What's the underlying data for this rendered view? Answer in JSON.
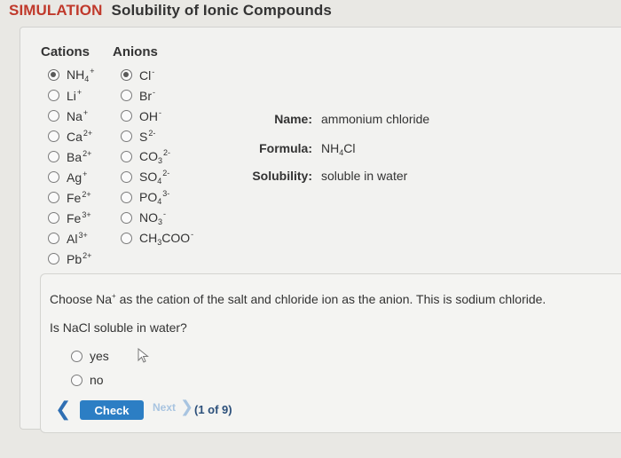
{
  "header": {
    "prefix": "SIMULATION",
    "title": "Solubility of Ionic Compounds"
  },
  "cations": {
    "heading": "Cations",
    "selected": "NH4+",
    "items": [
      {
        "base": "NH",
        "sub": "4",
        "sup": "+"
      },
      {
        "base": "Li",
        "sub": "",
        "sup": "+"
      },
      {
        "base": "Na",
        "sub": "",
        "sup": "+"
      },
      {
        "base": "Ca",
        "sub": "",
        "sup": "2+"
      },
      {
        "base": "Ba",
        "sub": "",
        "sup": "2+"
      },
      {
        "base": "Ag",
        "sub": "",
        "sup": "+"
      },
      {
        "base": "Fe",
        "sub": "",
        "sup": "2+"
      },
      {
        "base": "Fe",
        "sub": "",
        "sup": "3+"
      },
      {
        "base": "Al",
        "sub": "",
        "sup": "3+"
      },
      {
        "base": "Pb",
        "sub": "",
        "sup": "2+"
      }
    ]
  },
  "anions": {
    "heading": "Anions",
    "selected": "Cl-",
    "items": [
      {
        "base": "Cl",
        "sub": "",
        "sup": "-"
      },
      {
        "base": "Br",
        "sub": "",
        "sup": "-"
      },
      {
        "base": "OH",
        "sub": "",
        "sup": "-"
      },
      {
        "base": "S",
        "sub": "",
        "sup": "2-"
      },
      {
        "base": "CO",
        "sub": "3",
        "sup": "2-"
      },
      {
        "base": "SO",
        "sub": "4",
        "sup": "2-"
      },
      {
        "base": "PO",
        "sub": "4",
        "sup": "3-"
      },
      {
        "base": "NO",
        "sub": "3",
        "sup": "-"
      },
      {
        "base": "CH",
        "sub": "3",
        "tail": "COO",
        "sup": "-"
      }
    ]
  },
  "info": {
    "name_label": "Name:",
    "name_value": "ammonium chloride",
    "formula_label": "Formula:",
    "formula_base": "NH",
    "formula_sub": "4",
    "formula_tail": "Cl",
    "solubility_label": "Solubility:",
    "solubility_value": "soluble in water"
  },
  "question": {
    "line1_a": "Choose Na",
    "line1_sup": "+",
    "line1_b": " as the cation of the salt and chloride ion as the anion. This is sodium chloride.",
    "line2": "Is NaCl soluble in water?",
    "options": [
      "yes",
      "no"
    ]
  },
  "nav": {
    "back": "❮",
    "check_label": "Check",
    "next_label": "Next",
    "next_chevron": "❯",
    "page_count": "(1 of 9)"
  },
  "icons": {
    "cursor": "cursor-icon"
  }
}
